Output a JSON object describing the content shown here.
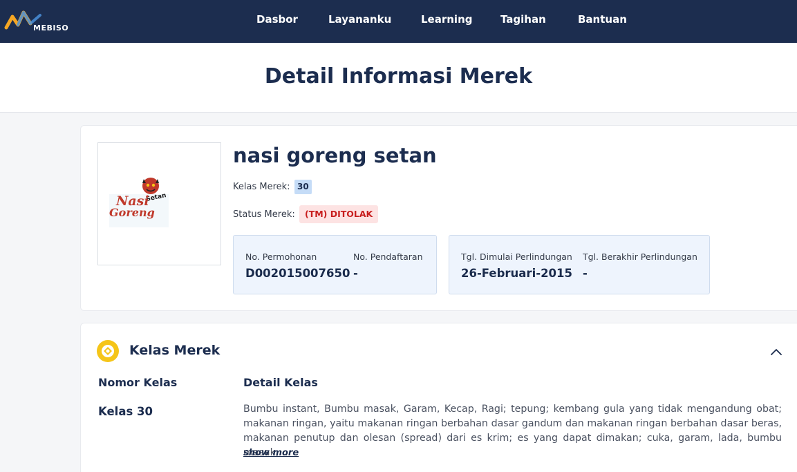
{
  "app": {
    "logo_text": "MEBISO"
  },
  "nav": {
    "items": [
      {
        "label": "Dasbor"
      },
      {
        "label": "Layananku"
      },
      {
        "label": "Learning"
      },
      {
        "label": "Tagihan"
      },
      {
        "label": "Bantuan"
      }
    ]
  },
  "page": {
    "title": "Detail Informasi Merek"
  },
  "brand": {
    "name": "nasi goreng setan",
    "image_text": {
      "line1": "Nasi",
      "line2": "Goreng",
      "badge": "Setan"
    },
    "class_label": "Kelas Merek:",
    "class_value": "30",
    "status_label": "Status Merek:",
    "status_value": "(TM) DITOLAK",
    "status_color": "#c81e1e",
    "registration": {
      "application_no_label": "No. Permohonan",
      "application_no_value": "D002015007650",
      "registration_no_label": "No. Pendaftaran",
      "registration_no_value": "-"
    },
    "protection": {
      "start_label": "Tgl. Dimulai Perlindungan",
      "start_value": "26-Februari-2015",
      "end_label": "Tgl. Berakhir Perlindungan",
      "end_value": "-"
    }
  },
  "kelas_section": {
    "icon": "brand-class-icon",
    "title": "Kelas Merek",
    "col_number": "Nomor Kelas",
    "col_detail": "Detail Kelas",
    "rows": [
      {
        "number": "Kelas 30",
        "detail": "Bumbu instant, Bumbu masak, Garam, Kecap, Ragi; tepung; kembang gula yang tidak mengandung obat; makanan ringan, yaitu makanan ringan berbahan dasar gandum dan makanan ringan berbahan dasar beras, makanan penutup dan olesan (spread) dari es krim; es yang dapat dimakan; cuka, garam, lada, bumbu masak, ..."
      }
    ],
    "show_more_label": "show more"
  },
  "colors": {
    "navbar_bg": "#1c2d4f",
    "accent_yellow": "#f5c518",
    "info_box_bg": "#eef4fd"
  }
}
